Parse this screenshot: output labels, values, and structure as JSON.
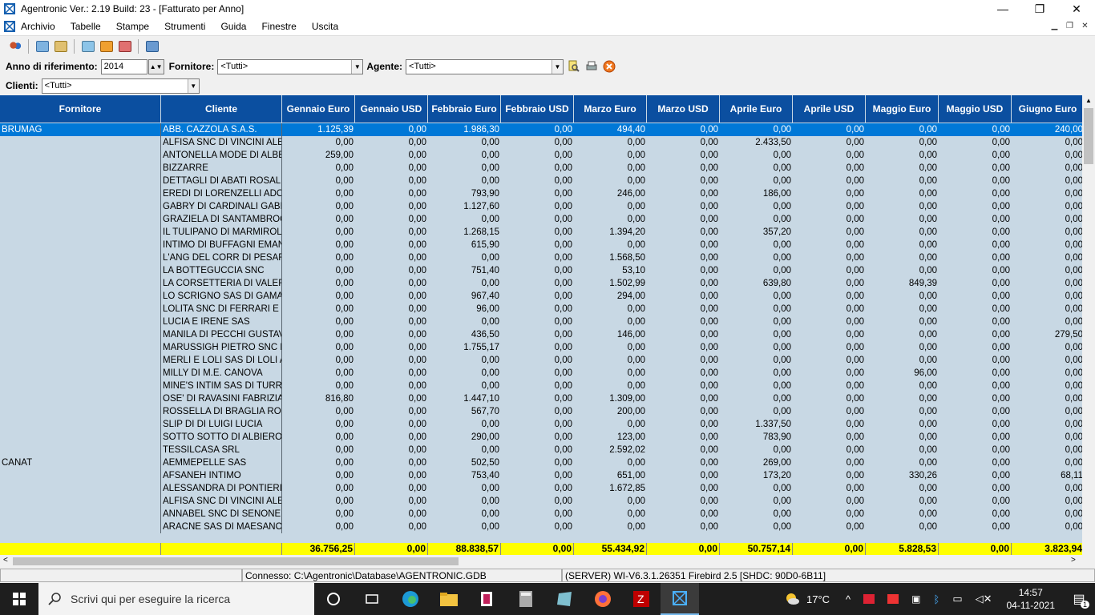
{
  "window": {
    "title": "Agentronic Ver.: 2.19 Build: 23  - [Fatturato per Anno]",
    "minimize": "—",
    "maximize": "❐",
    "close": "✕"
  },
  "menu": [
    "Archivio",
    "Tabelle",
    "Stampe",
    "Strumenti",
    "Guida",
    "Finestre",
    "Uscita"
  ],
  "filters": {
    "anno_label": "Anno di riferimento:",
    "anno_value": "2014",
    "fornitore_label": "Fornitore:",
    "fornitore_value": "<Tutti>",
    "agente_label": "Agente:",
    "agente_value": "<Tutti>",
    "clienti_label": "Clienti:",
    "clienti_value": "<Tutti>"
  },
  "table": {
    "columns": [
      "Fornitore",
      "Cliente",
      "Gennaio Euro",
      "Gennaio USD",
      "Febbraio Euro",
      "Febbraio USD",
      "Marzo Euro",
      "Marzo USD",
      "Aprile Euro",
      "Aprile USD",
      "Maggio Euro",
      "Maggio USD",
      "Giugno Euro"
    ],
    "rows": [
      [
        "BRUMAG",
        "ABB. CAZZOLA S.A.S.",
        "1.125,39",
        "0,00",
        "1.986,30",
        "0,00",
        "494,40",
        "0,00",
        "0,00",
        "0,00",
        "0,00",
        "0,00",
        "240,00"
      ],
      [
        "",
        "ALFISA SNC DI VINCINI ALES",
        "0,00",
        "0,00",
        "0,00",
        "0,00",
        "0,00",
        "0,00",
        "2.433,50",
        "0,00",
        "0,00",
        "0,00",
        "0,00"
      ],
      [
        "",
        "ANTONELLA MODE DI ALBER",
        "259,00",
        "0,00",
        "0,00",
        "0,00",
        "0,00",
        "0,00",
        "0,00",
        "0,00",
        "0,00",
        "0,00",
        "0,00"
      ],
      [
        "",
        "BIZZARRE",
        "0,00",
        "0,00",
        "0,00",
        "0,00",
        "0,00",
        "0,00",
        "0,00",
        "0,00",
        "0,00",
        "0,00",
        "0,00"
      ],
      [
        "",
        "DETTAGLI DI ABATI ROSALBA",
        "0,00",
        "0,00",
        "0,00",
        "0,00",
        "0,00",
        "0,00",
        "0,00",
        "0,00",
        "0,00",
        "0,00",
        "0,00"
      ],
      [
        "",
        "EREDI DI LORENZELLI ADOL",
        "0,00",
        "0,00",
        "793,90",
        "0,00",
        "246,00",
        "0,00",
        "186,00",
        "0,00",
        "0,00",
        "0,00",
        "0,00"
      ],
      [
        "",
        "GABRY DI CARDINALI GABRI",
        "0,00",
        "0,00",
        "1.127,60",
        "0,00",
        "0,00",
        "0,00",
        "0,00",
        "0,00",
        "0,00",
        "0,00",
        "0,00"
      ],
      [
        "",
        "GRAZIELA DI SANTAMBROGI",
        "0,00",
        "0,00",
        "0,00",
        "0,00",
        "0,00",
        "0,00",
        "0,00",
        "0,00",
        "0,00",
        "0,00",
        "0,00"
      ],
      [
        "",
        "IL TULIPANO DI MARMIROLI",
        "0,00",
        "0,00",
        "1.268,15",
        "0,00",
        "1.394,20",
        "0,00",
        "357,20",
        "0,00",
        "0,00",
        "0,00",
        "0,00"
      ],
      [
        "",
        "INTIMO DI BUFFAGNI EMANU",
        "0,00",
        "0,00",
        "615,90",
        "0,00",
        "0,00",
        "0,00",
        "0,00",
        "0,00",
        "0,00",
        "0,00",
        "0,00"
      ],
      [
        "",
        "L'ANG DEL CORR DI PESARE",
        "0,00",
        "0,00",
        "0,00",
        "0,00",
        "1.568,50",
        "0,00",
        "0,00",
        "0,00",
        "0,00",
        "0,00",
        "0,00"
      ],
      [
        "",
        "LA BOTTEGUCCIA SNC",
        "0,00",
        "0,00",
        "751,40",
        "0,00",
        "53,10",
        "0,00",
        "0,00",
        "0,00",
        "0,00",
        "0,00",
        "0,00"
      ],
      [
        "",
        "LA CORSETTERIA DI VALERI",
        "0,00",
        "0,00",
        "0,00",
        "0,00",
        "1.502,99",
        "0,00",
        "639,80",
        "0,00",
        "849,39",
        "0,00",
        "0,00"
      ],
      [
        "",
        "LO SCRIGNO SAS DI GAMALE",
        "0,00",
        "0,00",
        "967,40",
        "0,00",
        "294,00",
        "0,00",
        "0,00",
        "0,00",
        "0,00",
        "0,00",
        "0,00"
      ],
      [
        "",
        "LOLITA SNC DI FERRARI E FA",
        "0,00",
        "0,00",
        "96,00",
        "0,00",
        "0,00",
        "0,00",
        "0,00",
        "0,00",
        "0,00",
        "0,00",
        "0,00"
      ],
      [
        "",
        "LUCIA E IRENE SAS",
        "0,00",
        "0,00",
        "0,00",
        "0,00",
        "0,00",
        "0,00",
        "0,00",
        "0,00",
        "0,00",
        "0,00",
        "0,00"
      ],
      [
        "",
        "MANILA DI PECCHI GUSTAVO",
        "0,00",
        "0,00",
        "436,50",
        "0,00",
        "146,00",
        "0,00",
        "0,00",
        "0,00",
        "0,00",
        "0,00",
        "279,50"
      ],
      [
        "",
        "MARUSSIGH PIETRO SNC DI",
        "0,00",
        "0,00",
        "1.755,17",
        "0,00",
        "0,00",
        "0,00",
        "0,00",
        "0,00",
        "0,00",
        "0,00",
        "0,00"
      ],
      [
        "",
        "MERLI E LOLI SAS DI LOLI A.",
        "0,00",
        "0,00",
        "0,00",
        "0,00",
        "0,00",
        "0,00",
        "0,00",
        "0,00",
        "0,00",
        "0,00",
        "0,00"
      ],
      [
        "",
        "MILLY DI M.E. CANOVA",
        "0,00",
        "0,00",
        "0,00",
        "0,00",
        "0,00",
        "0,00",
        "0,00",
        "0,00",
        "96,00",
        "0,00",
        "0,00"
      ],
      [
        "",
        "MINE'S INTIM SAS DI TURRIN",
        "0,00",
        "0,00",
        "0,00",
        "0,00",
        "0,00",
        "0,00",
        "0,00",
        "0,00",
        "0,00",
        "0,00",
        "0,00"
      ],
      [
        "",
        "OSE' DI RAVASINI FABRIZIA",
        "816,80",
        "0,00",
        "1.447,10",
        "0,00",
        "1.309,00",
        "0,00",
        "0,00",
        "0,00",
        "0,00",
        "0,00",
        "0,00"
      ],
      [
        "",
        "ROSSELLA DI BRAGLIA ROSS",
        "0,00",
        "0,00",
        "567,70",
        "0,00",
        "200,00",
        "0,00",
        "0,00",
        "0,00",
        "0,00",
        "0,00",
        "0,00"
      ],
      [
        "",
        "SLIP DI DI LUIGI LUCIA",
        "0,00",
        "0,00",
        "0,00",
        "0,00",
        "0,00",
        "0,00",
        "1.337,50",
        "0,00",
        "0,00",
        "0,00",
        "0,00"
      ],
      [
        "",
        "SOTTO SOTTO DI ALBIERO M",
        "0,00",
        "0,00",
        "290,00",
        "0,00",
        "123,00",
        "0,00",
        "783,90",
        "0,00",
        "0,00",
        "0,00",
        "0,00"
      ],
      [
        "",
        "TESSILCASA SRL",
        "0,00",
        "0,00",
        "0,00",
        "0,00",
        "2.592,02",
        "0,00",
        "0,00",
        "0,00",
        "0,00",
        "0,00",
        "0,00"
      ],
      [
        "CANAT",
        "AEMMEPELLE SAS",
        "0,00",
        "0,00",
        "502,50",
        "0,00",
        "0,00",
        "0,00",
        "269,00",
        "0,00",
        "0,00",
        "0,00",
        "0,00"
      ],
      [
        "",
        "AFSANEH INTIMO",
        "0,00",
        "0,00",
        "753,40",
        "0,00",
        "651,00",
        "0,00",
        "173,20",
        "0,00",
        "330,26",
        "0,00",
        "68,11"
      ],
      [
        "",
        "ALESSANDRA DI PONTIERI S",
        "0,00",
        "0,00",
        "0,00",
        "0,00",
        "1.672,85",
        "0,00",
        "0,00",
        "0,00",
        "0,00",
        "0,00",
        "0,00"
      ],
      [
        "",
        "ALFISA SNC DI VINCINI ALES",
        "0,00",
        "0,00",
        "0,00",
        "0,00",
        "0,00",
        "0,00",
        "0,00",
        "0,00",
        "0,00",
        "0,00",
        "0,00"
      ],
      [
        "",
        "ANNABEL SNC DI SENONER",
        "0,00",
        "0,00",
        "0,00",
        "0,00",
        "0,00",
        "0,00",
        "0,00",
        "0,00",
        "0,00",
        "0,00",
        "0,00"
      ],
      [
        "",
        "ARACNE SAS DI MAESANO G",
        "0,00",
        "0,00",
        "0,00",
        "0,00",
        "0,00",
        "0,00",
        "0,00",
        "0,00",
        "0,00",
        "0,00",
        "0,00"
      ]
    ],
    "totals": [
      "",
      "",
      "36.756,25",
      "0,00",
      "88.838,57",
      "0,00",
      "55.434,92",
      "0,00",
      "50.757,14",
      "0,00",
      "5.828,53",
      "0,00",
      "3.823,94"
    ]
  },
  "status": {
    "connection": "Connesso: C:\\Agentronic\\Database\\AGENTRONIC.GDB",
    "server": "(SERVER) WI-V6.3.1.26351 Firebird 2.5 [SHDC: 90D0-6B11]"
  },
  "taskbar": {
    "search_placeholder": "Scrivi qui per eseguire la ricerca",
    "temperature": "17°C",
    "time": "14:57",
    "date": "04-11-2021",
    "notifications": "1"
  }
}
